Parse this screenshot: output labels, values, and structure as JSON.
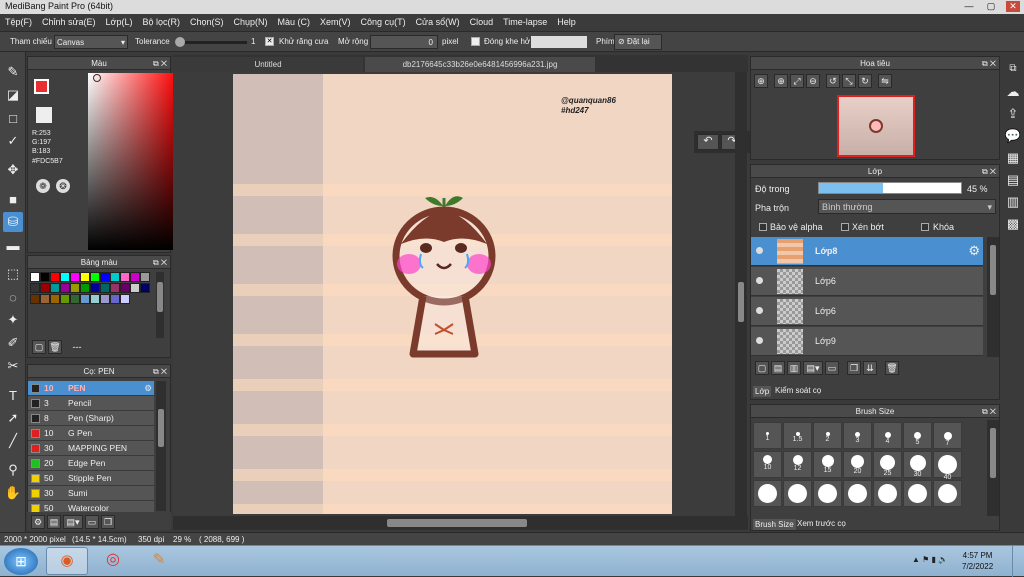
{
  "app": {
    "title": "MediBang Paint Pro (64bit)"
  },
  "menu": [
    "Tệp(F)",
    "Chỉnh sửa(E)",
    "Lớp(L)",
    "Bộ lọc(R)",
    "Chọn(S)",
    "Chụp(N)",
    "Màu (C)",
    "Xem(V)",
    "Công cụ(T)",
    "Cửa sổ(W)",
    "Cloud",
    "Time-lapse",
    "Help"
  ],
  "toolopt": {
    "ref_label": "Tham chiếu",
    "ref_value": "Canvas",
    "tol_label": "Tolerance",
    "tol_value": "1",
    "aa_label": "Khử răng cưa",
    "expand_label": "Mở rộng",
    "expand_value": "0",
    "expand_unit": "pixel",
    "gap_label": "Đóng khe hở",
    "key_label": "Phím",
    "reset_label": "Đặt lại"
  },
  "color_panel": {
    "title": "Màu",
    "r": "R:253",
    "g": "G:197",
    "b": "B:183",
    "hex": "#FDC5B7",
    "fg": "#e83030",
    "bg": "#ffffff"
  },
  "palette": {
    "title": "Bảng màu",
    "label": "---",
    "colors": [
      "#ffffff",
      "#000000",
      "#ff0000",
      "#00ffff",
      "#ff00ff",
      "#ffff00",
      "#00ff00",
      "#0000ff",
      "#00cccc",
      "#ff66cc",
      "#cc00cc",
      "#999999",
      "#333333",
      "#990000",
      "#009999",
      "#990099",
      "#999900",
      "#009900",
      "#000099",
      "#006666",
      "#993366",
      "#660066",
      "#cccccc",
      "#000066",
      "#663300",
      "#996633",
      "#996600",
      "#669900",
      "#336633",
      "#6699cc",
      "#99cccc",
      "#9999cc",
      "#6666cc",
      "#ccccff"
    ]
  },
  "brush_panel": {
    "title": "Cọ: PEN",
    "items": [
      {
        "size": "10",
        "name": "PEN",
        "color": "#222222"
      },
      {
        "size": "3",
        "name": "Pencil",
        "color": "#222222"
      },
      {
        "size": "8",
        "name": "Pen (Sharp)",
        "color": "#222222"
      },
      {
        "size": "10",
        "name": "G Pen",
        "color": "#e02020"
      },
      {
        "size": "30",
        "name": "MAPPING PEN",
        "color": "#e02020"
      },
      {
        "size": "20",
        "name": "Edge Pen",
        "color": "#20c020"
      },
      {
        "size": "50",
        "name": "Stipple Pen",
        "color": "#f0d000"
      },
      {
        "size": "30",
        "name": "Sumi",
        "color": "#f0d000"
      },
      {
        "size": "50",
        "name": "Watercolor",
        "color": "#f0d000"
      }
    ]
  },
  "tabs": [
    "Untitled",
    "db2176645c33b26e0e6481456996a231.jpg"
  ],
  "art": {
    "watermark1": "@quanquan86",
    "watermark2": "#hd247"
  },
  "navigator": {
    "title": "Hoa tiêu"
  },
  "layers": {
    "title": "Lớp",
    "opacity_label": "Độ trong",
    "opacity_value": "45 %",
    "opacity": 0.45,
    "blend_label": "Pha trộn",
    "blend_value": "Bình thường",
    "protect_alpha": "Bảo vệ alpha",
    "clipping": "Xén bớt",
    "lock": "Khóa",
    "items": [
      {
        "name": "Lớp8"
      },
      {
        "name": "Lớp6"
      },
      {
        "name": "Lớp6"
      },
      {
        "name": "Lớp9"
      }
    ],
    "tab1": "Lớp",
    "tab2": "Kiểm soát cọ"
  },
  "brush_size": {
    "title": "Brush Size",
    "sizes": [
      "1",
      "1.5",
      "2",
      "3",
      "4",
      "5",
      "7",
      "10",
      "12",
      "15",
      "20",
      "25",
      "30",
      "40",
      "",
      "",
      "",
      "",
      "",
      "",
      ""
    ],
    "tab1": "Brush Size",
    "tab2": "Xem trước cọ"
  },
  "status": {
    "size": "2000 * 2000 pixel",
    "cm": "(14.5 * 14.5cm)",
    "dpi": "350 dpi",
    "zoom": "29 %",
    "coords": "( 2088, 699 )"
  },
  "taskbar": {
    "time": "4:57 PM",
    "date": "7/2/2022"
  }
}
